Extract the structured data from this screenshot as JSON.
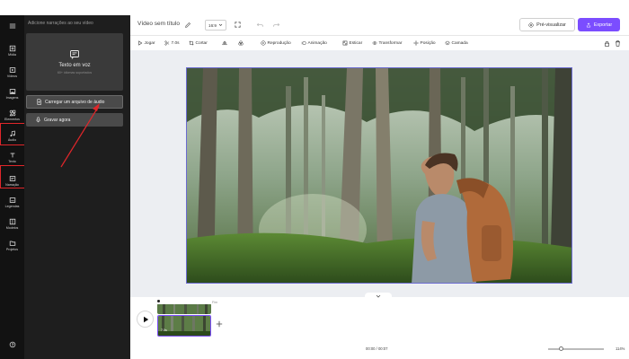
{
  "rail": {
    "items": [
      {
        "label": "Mídia",
        "icon": "media-icon"
      },
      {
        "label": "Vídeos",
        "icon": "video-icon"
      },
      {
        "label": "Imagens",
        "icon": "image-icon"
      },
      {
        "label": "Elementos",
        "icon": "elements-icon"
      },
      {
        "label": "Áudio",
        "icon": "music-note-icon"
      },
      {
        "label": "Texto",
        "icon": "text-icon"
      },
      {
        "label": "Narração",
        "icon": "narration-icon"
      },
      {
        "label": "Legendas",
        "icon": "subtitles-icon"
      },
      {
        "label": "Modelos",
        "icon": "templates-icon"
      },
      {
        "label": "Projetos",
        "icon": "folder-icon"
      }
    ],
    "help_icon": "help-icon"
  },
  "panel": {
    "title": "Adicione narrações ao seu vídeo",
    "tts_title": "Texto em voz",
    "tts_subtitle": "60+ idiomas suportados",
    "upload_label": "Carregar um arquivo de áudio",
    "record_label": "Gravar agora"
  },
  "header": {
    "title": "Vídeo sem título",
    "aspect_ratio": "16:9",
    "preview_label": "Pré-visualizar",
    "export_label": "Exportar"
  },
  "toolbar": {
    "items": [
      {
        "label": "Jogar",
        "icon": "play-icon"
      },
      {
        "label": "7.0s",
        "icon": "split-icon"
      },
      {
        "label": "Cortar",
        "icon": "crop-icon"
      },
      {
        "label": "",
        "icon": "flip-icon"
      },
      {
        "label": "",
        "icon": "filter-icon"
      },
      {
        "label": "Reprodução",
        "icon": "playback-icon"
      },
      {
        "label": "Animação",
        "icon": "animation-icon"
      },
      {
        "label": "Esticar",
        "icon": "stretch-icon"
      },
      {
        "label": "Transformar",
        "icon": "transform-icon"
      },
      {
        "label": "Posição",
        "icon": "position-icon"
      },
      {
        "label": "Camada",
        "icon": "layer-icon"
      }
    ]
  },
  "timeline": {
    "duration_label": "Fim",
    "clip_duration": "7.0s"
  },
  "status": {
    "time": "00:00 / 00:07",
    "zoom": "114%"
  },
  "colors": {
    "accent": "#7b4dff",
    "highlight": "#e0262a",
    "rail_bg": "#121212",
    "panel_bg": "#1e1e1e"
  }
}
